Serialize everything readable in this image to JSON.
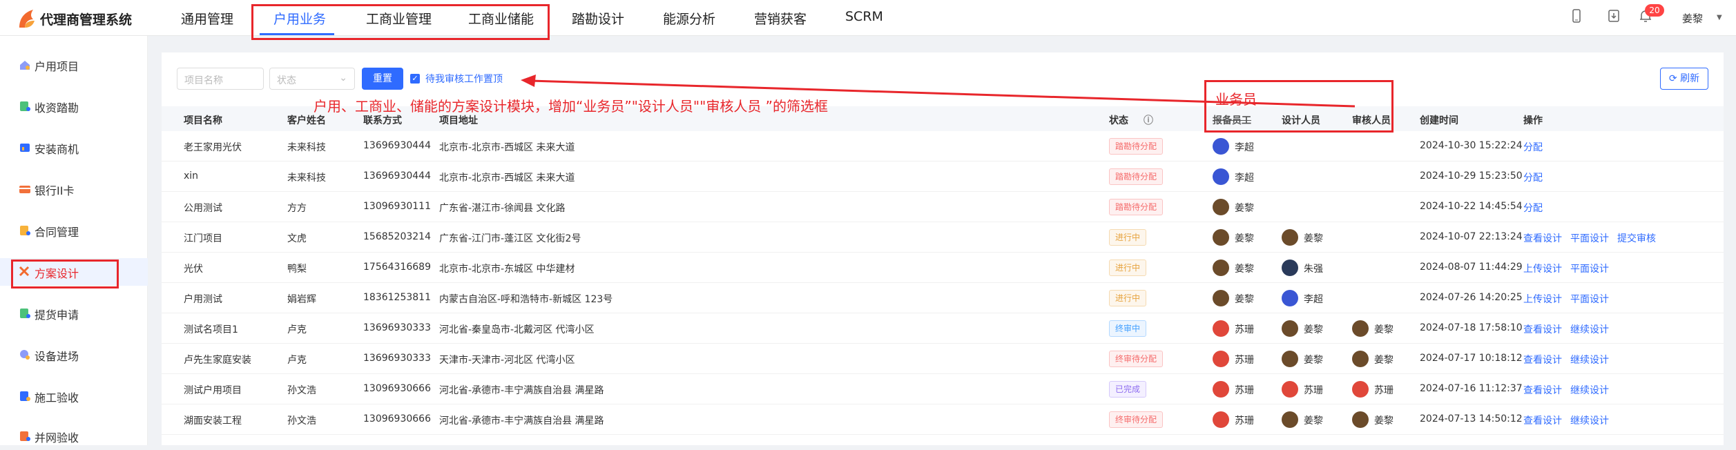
{
  "app": {
    "title": "代理商管理系统"
  },
  "nav": {
    "items": [
      "通用管理",
      "户用业务",
      "工商业管理",
      "工商业储能",
      "踏勘设计",
      "能源分析",
      "营销获客",
      "SCRM"
    ]
  },
  "header": {
    "notification_count": "20",
    "user_name": "姜黎"
  },
  "sidebar": {
    "items": [
      "户用项目",
      "收资踏勘",
      "安装商机",
      "银行II卡",
      "合同管理",
      "方案设计",
      "提货申请",
      "设备进场",
      "施工验收",
      "并网验收"
    ]
  },
  "filters": {
    "project_name_placeholder": "项目名称",
    "status_placeholder": "状态",
    "reset_label": "重置",
    "pending_checkbox_label": "待我审核工作置顶",
    "refresh_label": "刷新"
  },
  "annotation": {
    "text": "户用、工商业、储能的方案设计模块，增加“业务员”\"设计人员\"\"审核人员 ”的筛选框",
    "box_label": "业务员"
  },
  "table": {
    "columns": [
      "项目名称",
      "客户姓名",
      "联系方式",
      "项目地址",
      "状态",
      "报备员工",
      "设计人员",
      "审核人员",
      "创建时间",
      "操作"
    ],
    "rows": [
      {
        "name": "老王家用光伏",
        "customer": "未来科技",
        "phone": "13696930444",
        "address": "北京市-北京市-西城区 未来大道",
        "status": "踏勘待分配",
        "staff": "李超",
        "designer": "",
        "reviewer": "",
        "created": "2024-10-30 15:22:24",
        "actions": [
          "分配"
        ]
      },
      {
        "name": "xin",
        "customer": "未来科技",
        "phone": "13696930444",
        "address": "北京市-北京市-西城区 未来大道",
        "status": "踏勘待分配",
        "staff": "李超",
        "designer": "",
        "reviewer": "",
        "created": "2024-10-29 15:23:50",
        "actions": [
          "分配"
        ]
      },
      {
        "name": "公用测试",
        "customer": "方方",
        "phone": "13096930111",
        "address": "广东省-湛江市-徐闻县 文化路",
        "status": "踏勘待分配",
        "staff": "姜黎",
        "designer": "",
        "reviewer": "",
        "created": "2024-10-22 14:45:54",
        "actions": [
          "分配"
        ]
      },
      {
        "name": "江门项目",
        "customer": "文虎",
        "phone": "15685203214",
        "address": "广东省-江门市-蓬江区 文化街2号",
        "status": "进行中",
        "staff": "姜黎",
        "designer": "姜黎",
        "reviewer": "",
        "created": "2024-10-07 22:13:24",
        "actions": [
          "查看设计",
          "平面设计",
          "提交审核"
        ]
      },
      {
        "name": "光伏",
        "customer": "鸭梨",
        "phone": "17564316689",
        "address": "北京市-北京市-东城区 中华建材",
        "status": "进行中",
        "staff": "姜黎",
        "designer": "朱强",
        "reviewer": "",
        "created": "2024-08-07 11:44:29",
        "actions": [
          "上传设计",
          "平面设计"
        ]
      },
      {
        "name": "户用测试",
        "customer": "娟岩辉",
        "phone": "18361253811",
        "address": "内蒙古自治区-呼和浩特市-新城区 123号",
        "status": "进行中",
        "staff": "姜黎",
        "designer": "李超",
        "reviewer": "",
        "created": "2024-07-26 14:20:25",
        "actions": [
          "上传设计",
          "平面设计"
        ]
      },
      {
        "name": "测试名项目1",
        "customer": "卢克",
        "phone": "13696930333",
        "address": "河北省-秦皇岛市-北戴河区 代湾小区",
        "status": "终审中",
        "staff": "苏珊",
        "designer": "姜黎",
        "reviewer": "姜黎",
        "created": "2024-07-18 17:58:10",
        "actions": [
          "查看设计",
          "继续设计"
        ]
      },
      {
        "name": "卢先生家庭安装",
        "customer": "卢克",
        "phone": "13696930333",
        "address": "天津市-天津市-河北区 代湾小区",
        "status": "终审待分配",
        "staff": "苏珊",
        "designer": "姜黎",
        "reviewer": "姜黎",
        "created": "2024-07-17 10:18:12",
        "actions": [
          "查看设计",
          "继续设计"
        ]
      },
      {
        "name": "测试户用项目",
        "customer": "孙文浩",
        "phone": "13096930666",
        "address": "河北省-承德市-丰宁满族自治县 满星路",
        "status": "已完成",
        "staff": "苏珊",
        "designer": "苏珊",
        "reviewer": "苏珊",
        "created": "2024-07-16 11:12:37",
        "actions": [
          "查看设计",
          "继续设计"
        ]
      },
      {
        "name": "湖面安装工程",
        "customer": "孙文浩",
        "phone": "13096930666",
        "address": "河北省-承德市-丰宁满族自治县 满星路",
        "status": "终审待分配",
        "staff": "苏珊",
        "designer": "姜黎",
        "reviewer": "姜黎",
        "created": "2024-07-13 14:50:12",
        "actions": [
          "查看设计",
          "继续设计"
        ]
      }
    ]
  },
  "colors": {
    "accent": "#2f6bff",
    "annotation": "#e8262b",
    "tag_red": "#f56c6c",
    "tag_orange": "#e6a23c",
    "tag_blue": "#409eff",
    "tag_purple": "#8e6cf0"
  }
}
